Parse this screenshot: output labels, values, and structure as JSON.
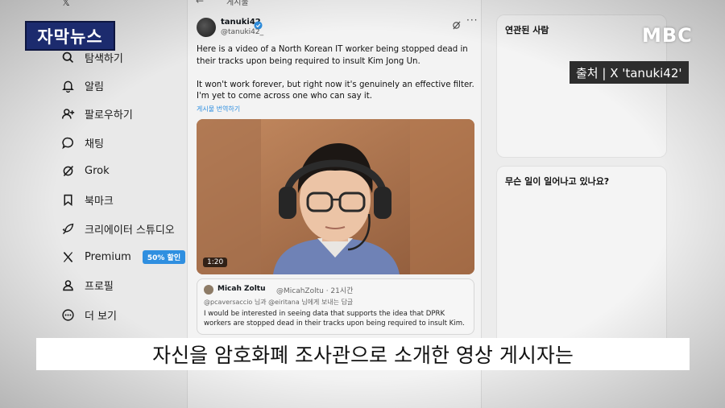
{
  "nav": {
    "items": [
      {
        "label": "탐색하기",
        "icon": "search-icon"
      },
      {
        "label": "알림",
        "icon": "bell-icon"
      },
      {
        "label": "팔로우하기",
        "icon": "add-user-icon"
      },
      {
        "label": "채팅",
        "icon": "chat-icon"
      },
      {
        "label": "Grok",
        "icon": "grok-icon"
      },
      {
        "label": "북마크",
        "icon": "bookmark-icon"
      },
      {
        "label": "크리에이터 스튜디오",
        "icon": "rocket-icon"
      },
      {
        "label": "Premium",
        "icon": "x-logo-icon",
        "badge": "50% 할인"
      },
      {
        "label": "프로필",
        "icon": "profile-icon"
      },
      {
        "label": "더 보기",
        "icon": "more-circle-icon"
      }
    ]
  },
  "feed": {
    "header_label": "게시물",
    "tweet": {
      "author_name": "tanuki42",
      "author_handle": "@tanuki42_",
      "paragraphs": [
        "Here is a video of a North Korean IT worker being stopped dead in their tracks upon being required to insult Kim Jong Un.",
        "It won't work forever, but right now it's genuinely an effective filter. I'm yet to come across one who can say it."
      ],
      "translate_link": "게시물 번역하기",
      "video_duration": "1:20"
    },
    "quote": {
      "name": "Micah Zoltu",
      "handle": "@MicahZoltu · 21시간",
      "reply_to": "@pcaversaccio 님과 @eiritana 님에게 보내는 답글",
      "text": "I would be interested in seeing data that supports the idea that DPRK workers are stopped dead in their tracks upon being required to insult Kim."
    }
  },
  "right": {
    "related_title": "연관된 사람",
    "trending_title": "무슨 일이 일어나고 있나요?"
  },
  "overlay": {
    "news_logo": "자막뉴스",
    "broadcaster": "MBC",
    "source": "출처 | X 'tanuki42'",
    "subtitle": "자신을 암호화폐 조사관으로 소개한 영상 게시자는"
  },
  "colors": {
    "accent": "#2f8fe0",
    "news_logo_bg": "#1c2b6e",
    "source_bg": "#2d2d2d",
    "subtitle_bg": "#ffffff"
  }
}
